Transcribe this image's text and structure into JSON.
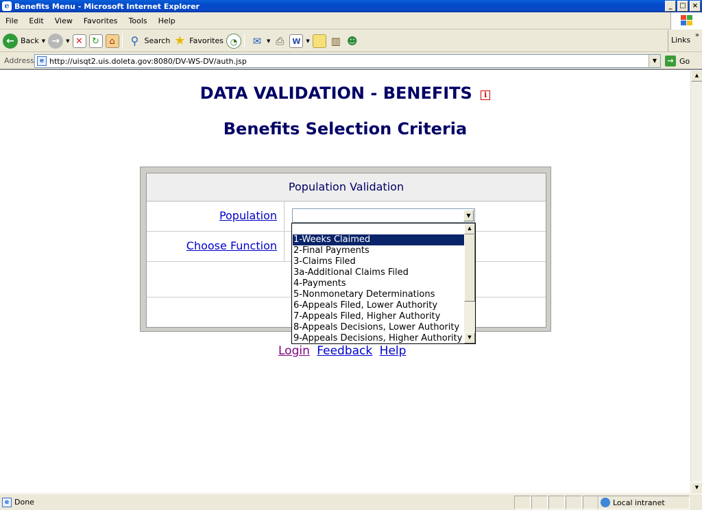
{
  "window": {
    "title": "Benefits Menu - Microsoft Internet Explorer",
    "controls": [
      "_",
      "□",
      "×"
    ]
  },
  "menubar": {
    "items": [
      "File",
      "Edit",
      "View",
      "Favorites",
      "Tools",
      "Help"
    ]
  },
  "toolbar": {
    "back_label": "Back",
    "search_label": "Search",
    "favorites_label": "Favorites",
    "links_label": "Links"
  },
  "address": {
    "label": "Address",
    "url": "http://uisqt2.uis.doleta.gov:8080/DV-WS-DV/auth.jsp",
    "go_label": "Go"
  },
  "page": {
    "title": "DATA VALIDATION - BENEFITS",
    "info_glyph": "i",
    "subtitle": "Benefits Selection Criteria",
    "panel_header": "Population Validation",
    "population_link": "Population",
    "choose_function_link": "Choose Function",
    "population_select": {
      "value": "",
      "options": [
        "1-Weeks Claimed",
        "2-Final Payments",
        "3-Claims Filed",
        "3a-Additional Claims Filed",
        "4-Payments",
        "5-Nonmonetary Determinations",
        "6-Appeals Filed, Lower Authority",
        "7-Appeals Filed, Higher Authority",
        "8-Appeals Decisions, Lower Authority",
        "9-Appeals Decisions, Higher Authority"
      ],
      "highlighted": "1-Weeks Claimed"
    },
    "footer_links": {
      "login": "Login",
      "feedback": "Feedback",
      "help": "Help"
    }
  },
  "statusbar": {
    "status": "Done",
    "zone": "Local intranet"
  },
  "colors": {
    "heading": "#000066",
    "link": "#0000cc",
    "visited_link": "#800080",
    "selection": "#0a246a"
  }
}
